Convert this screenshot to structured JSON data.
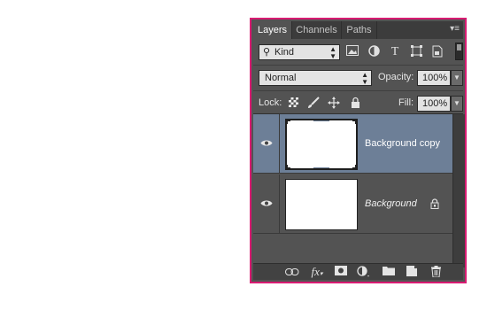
{
  "tabs": [
    {
      "label": "Layers",
      "active": true
    },
    {
      "label": "Channels",
      "active": false
    },
    {
      "label": "Paths",
      "active": false
    }
  ],
  "panel_menu_icon": "panel-menu-icon",
  "filter": {
    "value": "Kind",
    "icon": "search-icon"
  },
  "filter_icons": [
    "pixel-layer-filter-icon",
    "adjustment-layer-filter-icon",
    "type-layer-filter-icon",
    "shape-layer-filter-icon",
    "smart-object-filter-icon"
  ],
  "blend_mode": {
    "value": "Normal"
  },
  "opacity": {
    "label": "Opacity:",
    "value": "100%"
  },
  "lock": {
    "label": "Lock:",
    "icons": [
      "lock-transparent-pixels-icon",
      "lock-image-pixels-icon",
      "lock-position-icon",
      "lock-all-icon"
    ]
  },
  "fill": {
    "label": "Fill:",
    "value": "100%"
  },
  "layers": [
    {
      "name": "Background copy",
      "visible": true,
      "selected": true,
      "locked": false,
      "italic": false
    },
    {
      "name": "Background",
      "visible": true,
      "selected": false,
      "locked": true,
      "italic": true
    }
  ],
  "bottom_icons": [
    "link-layers-icon",
    "fx-icon",
    "add-mask-icon",
    "adjustment-layer-icon",
    "new-group-icon",
    "new-layer-icon",
    "delete-icon"
  ],
  "colors": {
    "frame": "#d81b72",
    "panel": "#535353",
    "selected_row": "#6d7f97"
  }
}
